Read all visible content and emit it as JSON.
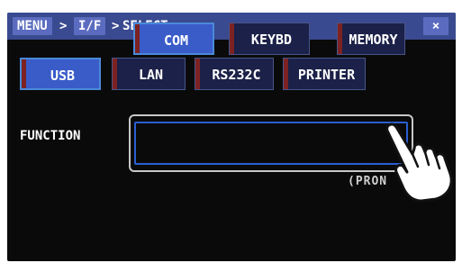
{
  "header": {
    "crumbs": [
      "MENU",
      "I/F",
      "SELECT"
    ],
    "sep": ">",
    "close_label": "×"
  },
  "tabs": [
    {
      "label": "USB",
      "active": true
    },
    {
      "label": "LAN",
      "active": false
    },
    {
      "label": "RS232C",
      "active": false
    },
    {
      "label": "PRINTER",
      "active": false
    }
  ],
  "function": {
    "label": "FUNCTION",
    "options": [
      {
        "label": "COM",
        "active": true
      },
      {
        "label": "KEYBD",
        "active": false
      },
      {
        "label": "MEMORY",
        "active": false
      }
    ]
  },
  "overlay_text": "(PRON",
  "colors": {
    "titlebar": "#3a4a90",
    "active_tab": "#3a5cc9",
    "inactive_tab": "#1b2148",
    "tab_bar_accent": "#7d2222",
    "highlight_outline": "#2a5fd0"
  }
}
